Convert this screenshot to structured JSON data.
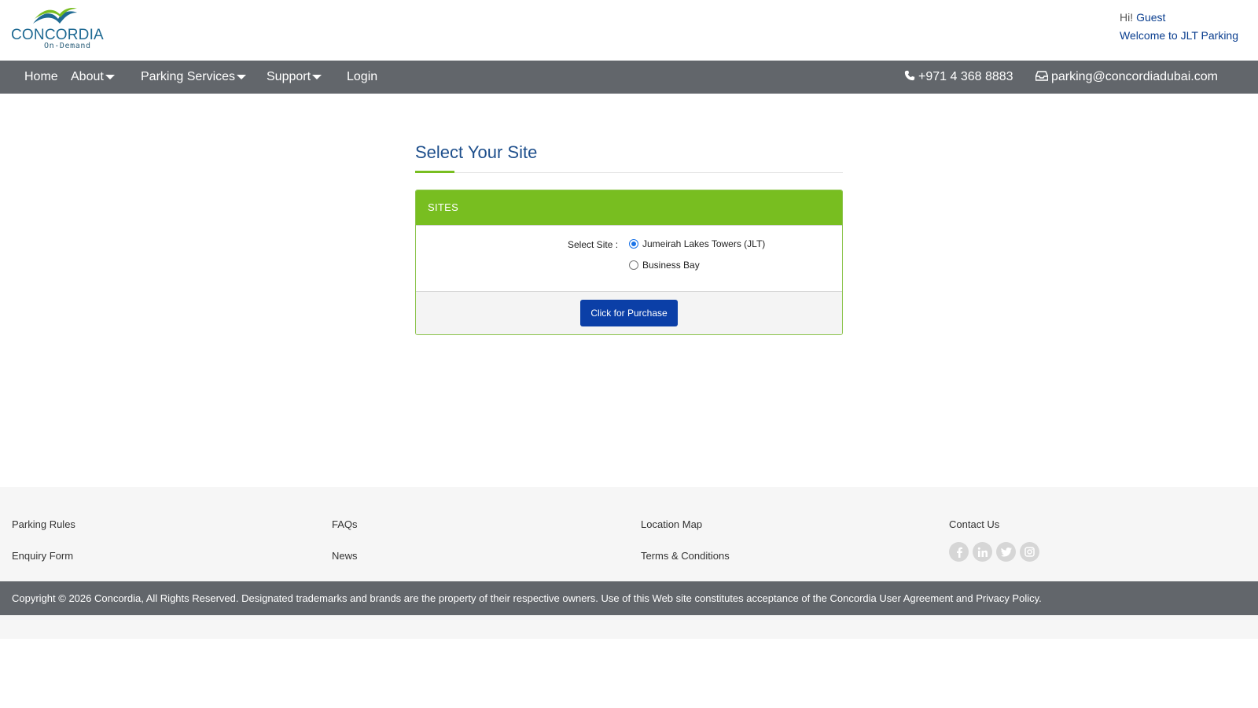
{
  "header": {
    "logo": {
      "name": "CONCORDIA",
      "sub": "On-Demand"
    },
    "greeting": {
      "hi": "Hi!",
      "user": "Guest",
      "welcome": "Welcome to JLT Parking"
    }
  },
  "nav": {
    "items": [
      {
        "label": "Home",
        "dropdown": false
      },
      {
        "label": "About",
        "dropdown": true
      },
      {
        "label": "Parking Services",
        "dropdown": true
      },
      {
        "label": "Support",
        "dropdown": true
      },
      {
        "label": "Login",
        "dropdown": false
      }
    ],
    "phone": "+971 4 368 8883",
    "email": "parking@concordiadubai.com"
  },
  "main": {
    "title": "Select Your Site",
    "panel": {
      "heading": "SITES",
      "select_label": "Select Site :",
      "options": [
        {
          "label": "Jumeirah Lakes Towers (JLT)",
          "selected": true
        },
        {
          "label": "Business Bay",
          "selected": false
        }
      ],
      "button_label": "Click for Purchase"
    }
  },
  "footer": {
    "links": [
      "Parking Rules",
      "FAQs",
      "Location Map",
      "Contact Us",
      "Enquiry Form",
      "News",
      "Terms & Conditions"
    ],
    "social": [
      "facebook-icon",
      "linkedin-icon",
      "twitter-icon",
      "instagram-icon"
    ],
    "copyright": "Copyright © 2026 Concordia, All Rights Reserved. Designated trademarks and brands are the property of their respective owners. Use of this Web site constitutes acceptance of the Concordia User Agreement and Privacy Policy."
  },
  "colors": {
    "nav_bg": "#62666b",
    "accent_green": "#78be20",
    "title_blue": "#1e4f8c",
    "button_blue": "#0b3fa7"
  }
}
